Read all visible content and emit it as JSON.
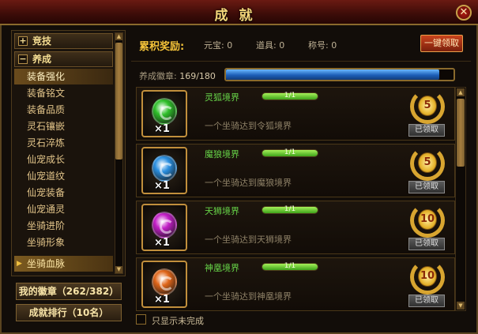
{
  "window": {
    "title": "成就",
    "close_glyph": "✕"
  },
  "sidebar": {
    "categories": [
      {
        "label": "竞技",
        "expanded": false,
        "toggle": "+"
      },
      {
        "label": "养成",
        "expanded": true,
        "toggle": "−"
      }
    ],
    "items": [
      {
        "label": "装备强化",
        "state": "hover"
      },
      {
        "label": "装备铭文"
      },
      {
        "label": "装备品质"
      },
      {
        "label": "灵石镶嵌"
      },
      {
        "label": "灵石淬炼"
      },
      {
        "label": "仙宠成长"
      },
      {
        "label": "仙宠道纹"
      },
      {
        "label": "仙宠装备"
      },
      {
        "label": "仙宠通灵"
      },
      {
        "label": "坐骑进阶"
      },
      {
        "label": "坐骑形象"
      },
      {
        "label": "坐骑血脉",
        "state": "selected",
        "marker": "▶"
      }
    ],
    "scroll_up": "▲",
    "scroll_down": "▼",
    "my_badges_button": "我的徽章（262/382）",
    "ranking_button": "成就排行（10名）"
  },
  "rewards": {
    "label": "累积奖励:",
    "yuanbao": "元宝: 0",
    "items": "道具: 0",
    "titles": "称号: 0",
    "collect_all": "一键领取"
  },
  "badge_progress": {
    "label": "养成徽章:",
    "value": "169/180",
    "current": 169,
    "total": 180
  },
  "achievements": [
    {
      "name": "灵狐境界",
      "progress_text": "1/1",
      "progress": 1.0,
      "desc": "一个坐骑达到令狐境界",
      "qty": "×1",
      "orb_color": "#2fbf2a",
      "medal": "5",
      "status": "已领取"
    },
    {
      "name": "魔狼境界",
      "progress_text": "1/1",
      "progress": 1.0,
      "desc": "一个坐骑达到魔狼境界",
      "qty": "×1",
      "orb_color": "#2a8fe0",
      "medal": "5",
      "status": "已领取"
    },
    {
      "name": "天狮境界",
      "progress_text": "1/1",
      "progress": 1.0,
      "desc": "一个坐骑达到天狮境界",
      "qty": "×1",
      "orb_color": "#c21fc6",
      "medal": "10",
      "status": "已领取"
    },
    {
      "name": "神凰境界",
      "progress_text": "1/1",
      "progress": 1.0,
      "desc": "一个坐骑达到神凰境界",
      "qty": "×1",
      "orb_color": "#e0661a",
      "medal": "10",
      "status": "已领取"
    }
  ],
  "list_scroll": {
    "up": "▲",
    "down": "▼"
  },
  "filter": {
    "label": "只显示未完成",
    "checked": false
  }
}
